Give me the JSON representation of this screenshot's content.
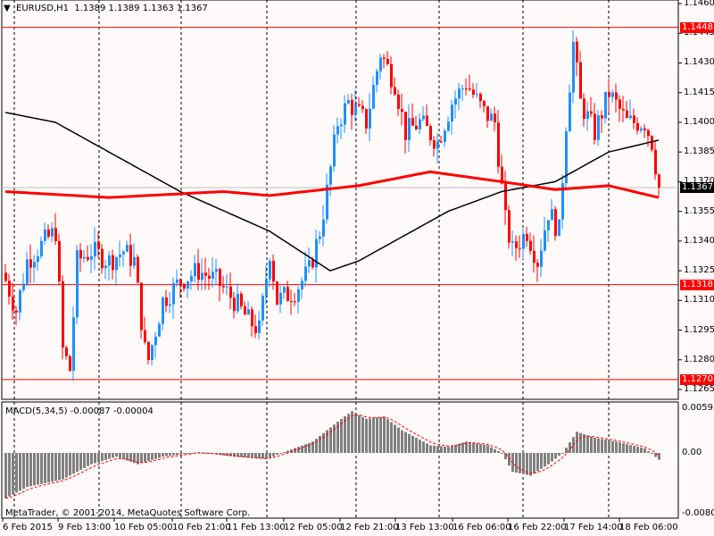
{
  "header": {
    "symbol": "EURUSD,H1",
    "ohlc": "1.1389 1.1389 1.1363 1.1367"
  },
  "macd_label": "MACD(5,34,5) -0.00087 -0.00004",
  "copyright": "MetaTrader, © 2001-2014, MetaQuotes Software Corp.",
  "price_levels": [
    {
      "value": "1.1448",
      "color": "#ff0000"
    },
    {
      "value": "1.1318",
      "color": "#ff0000"
    },
    {
      "value": "1.1270",
      "color": "#ff0000"
    },
    {
      "value": "1.1367",
      "color": "#000000"
    }
  ],
  "colors": {
    "up": "#1e90ff",
    "down": "#ff0000",
    "ma_fast": "#000000",
    "ma_slow": "#ff0000"
  },
  "chart_data": {
    "type": "candlestick",
    "ylim": [
      1.1261,
      1.1462
    ],
    "y_ticks": [
      "1.1460",
      "1.1445",
      "1.1430",
      "1.1415",
      "1.1400",
      "1.1385",
      "1.1370",
      "1.1355",
      "1.1340",
      "1.1325",
      "1.1310",
      "1.1295",
      "1.1280",
      "1.1265"
    ],
    "x_ticks": [
      "6 Feb 2015",
      "9 Feb 13:00",
      "10 Feb 05:00",
      "10 Feb 21:00",
      "11 Feb 13:00",
      "12 Feb 05:00",
      "12 Feb 21:00",
      "13 Feb 13:00",
      "16 Feb 06:00",
      "16 Feb 22:00",
      "17 Feb 14:00",
      "18 Feb 06:00"
    ],
    "candle_count": 184,
    "close_anchors": [
      [
        0,
        1.132
      ],
      [
        3,
        1.1305
      ],
      [
        6,
        1.133
      ],
      [
        11,
        1.134
      ],
      [
        14,
        1.1345
      ],
      [
        16,
        1.1285
      ],
      [
        18,
        1.1275
      ],
      [
        20,
        1.133
      ],
      [
        24,
        1.1335
      ],
      [
        29,
        1.133
      ],
      [
        33,
        1.1335
      ],
      [
        36,
        1.133
      ],
      [
        39,
        1.1285
      ],
      [
        40,
        1.128
      ],
      [
        44,
        1.131
      ],
      [
        49,
        1.132
      ],
      [
        54,
        1.1325
      ],
      [
        59,
        1.132
      ],
      [
        64,
        1.131
      ],
      [
        68,
        1.13
      ],
      [
        71,
        1.1295
      ],
      [
        74,
        1.1335
      ],
      [
        76,
        1.131
      ],
      [
        81,
        1.1315
      ],
      [
        85,
        1.1325
      ],
      [
        88,
        1.1345
      ],
      [
        90,
        1.1365
      ],
      [
        93,
        1.14
      ],
      [
        96,
        1.141
      ],
      [
        101,
        1.14
      ],
      [
        105,
        1.1435
      ],
      [
        109,
        1.142
      ],
      [
        112,
        1.1395
      ],
      [
        116,
        1.14
      ],
      [
        121,
        1.139
      ],
      [
        125,
        1.141
      ],
      [
        129,
        1.142
      ],
      [
        134,
        1.1405
      ],
      [
        137,
        1.14
      ],
      [
        140,
        1.135
      ],
      [
        142,
        1.1335
      ],
      [
        146,
        1.1345
      ],
      [
        149,
        1.133
      ],
      [
        152,
        1.1355
      ],
      [
        155,
        1.1345
      ],
      [
        157,
        1.14
      ],
      [
        159,
        1.144
      ],
      [
        161,
        1.141
      ],
      [
        165,
        1.1395
      ],
      [
        169,
        1.1415
      ],
      [
        174,
        1.14
      ],
      [
        179,
        1.14
      ],
      [
        181,
        1.139
      ],
      [
        183,
        1.1367
      ]
    ],
    "ma_fast_anchors": [
      [
        0,
        1.1405
      ],
      [
        14,
        1.14
      ],
      [
        29,
        1.1385
      ],
      [
        49,
        1.1365
      ],
      [
        74,
        1.1345
      ],
      [
        91,
        1.1325
      ],
      [
        99,
        1.133
      ],
      [
        114,
        1.1345
      ],
      [
        124,
        1.1355
      ],
      [
        139,
        1.1365
      ],
      [
        154,
        1.137
      ],
      [
        169,
        1.1385
      ],
      [
        183,
        1.1391
      ]
    ],
    "ma_slow_anchors": [
      [
        0,
        1.1365
      ],
      [
        29,
        1.1362
      ],
      [
        61,
        1.1365
      ],
      [
        74,
        1.1363
      ],
      [
        99,
        1.1368
      ],
      [
        119,
        1.1375
      ],
      [
        139,
        1.137
      ],
      [
        154,
        1.1366
      ],
      [
        169,
        1.1368
      ],
      [
        183,
        1.1362
      ]
    ],
    "macd": {
      "ylim": [
        -0.00803,
        0.0059
      ],
      "ticks": [
        "0.0059",
        "0.00",
        "-0.00803"
      ],
      "hist_anchors": [
        [
          0,
          -0.006
        ],
        [
          6,
          -0.0045
        ],
        [
          16,
          -0.0035
        ],
        [
          24,
          -0.0015
        ],
        [
          31,
          -0.0005
        ],
        [
          37,
          -0.0015
        ],
        [
          44,
          -0.0005
        ],
        [
          54,
          0.0001
        ],
        [
          64,
          -0.0005
        ],
        [
          73,
          -0.0008
        ],
        [
          79,
          0.0003
        ],
        [
          86,
          0.0015
        ],
        [
          94,
          0.0045
        ],
        [
          97,
          0.0055
        ],
        [
          101,
          0.0045
        ],
        [
          106,
          0.0048
        ],
        [
          111,
          0.003
        ],
        [
          119,
          0.001
        ],
        [
          124,
          0.0008
        ],
        [
          129,
          0.0015
        ],
        [
          135,
          0.001
        ],
        [
          139,
          0.0
        ],
        [
          142,
          -0.0025
        ],
        [
          147,
          -0.003
        ],
        [
          152,
          -0.0015
        ],
        [
          156,
          0.0
        ],
        [
          160,
          0.0028
        ],
        [
          165,
          0.002
        ],
        [
          171,
          0.0015
        ],
        [
          179,
          0.0006
        ],
        [
          183,
          -0.0009
        ]
      ]
    }
  }
}
